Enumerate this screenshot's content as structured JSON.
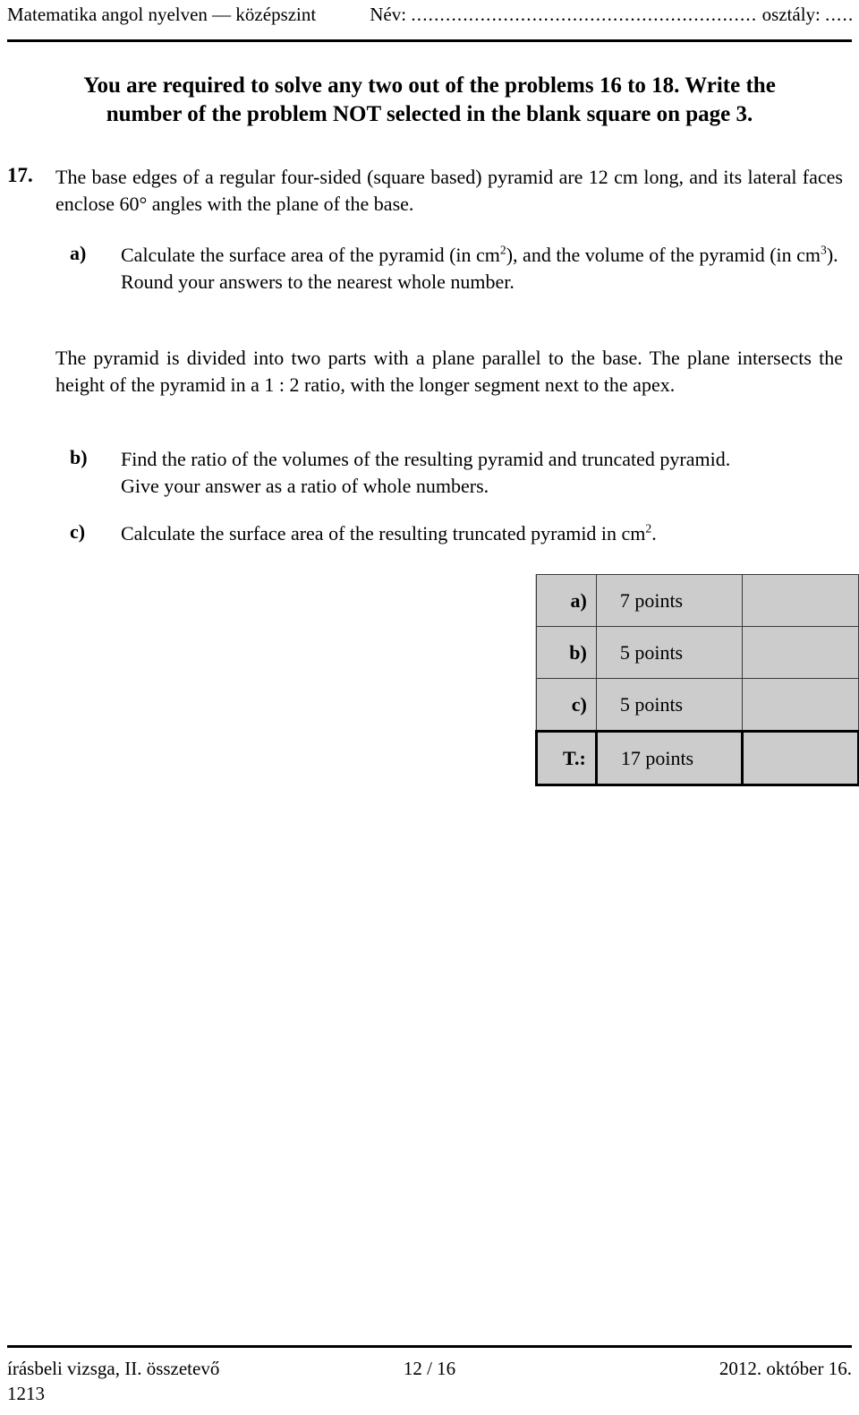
{
  "header": {
    "subject": "Matematika angol nyelven — középszint",
    "name_label": "Név:",
    "name_dots": "............................................................",
    "class_label": "osztály:",
    "class_dots": "......"
  },
  "instruction": {
    "line1": "You are required to solve any two out of the problems 16 to 18.  Write the",
    "line2": "number of the problem NOT selected in the blank square on page 3."
  },
  "problem": {
    "number": "17.",
    "stem": "The base edges of a regular four-sided (square based) pyramid are 12 cm long, and its lateral faces enclose 60° angles with the plane of the base.",
    "part_a_label": "a)",
    "part_a_line1_pre": "Calculate the surface area of the pyramid (in cm",
    "part_a_line1_sup": "2",
    "part_a_line1_mid": "), and the volume of the pyramid (in cm",
    "part_a_line1_sup2": "3",
    "part_a_line1_post": ").",
    "part_a_line2": "Round your answers to the nearest whole number.",
    "middle_para": "The pyramid is divided into two parts with a plane parallel to the base. The plane intersects the height of the pyramid in a 1 : 2 ratio, with the longer segment next to the apex.",
    "part_b_label": "b)",
    "part_b_line1": "Find the ratio of the volumes of the resulting pyramid and truncated pyramid.",
    "part_b_line2": "Give your answer as a ratio of whole numbers.",
    "part_c_label": "c)",
    "part_c_pre": "Calculate the surface area of the resulting truncated pyramid in cm",
    "part_c_sup": "2",
    "part_c_post": "."
  },
  "points_table": {
    "rows": [
      {
        "label": "a)",
        "value": "7 points",
        "score": ""
      },
      {
        "label": "b)",
        "value": "5 points",
        "score": ""
      },
      {
        "label": "c)",
        "value": "5 points",
        "score": ""
      },
      {
        "label": "T.:",
        "value": "17 points",
        "score": ""
      }
    ]
  },
  "footer": {
    "left": "írásbeli vizsga, II. összetevő",
    "center": "12 / 16",
    "right": "2012. október 16.",
    "code": "1213"
  },
  "colors": {
    "table_fill": "#cccccc",
    "rule": "#000000",
    "text": "#000000"
  }
}
